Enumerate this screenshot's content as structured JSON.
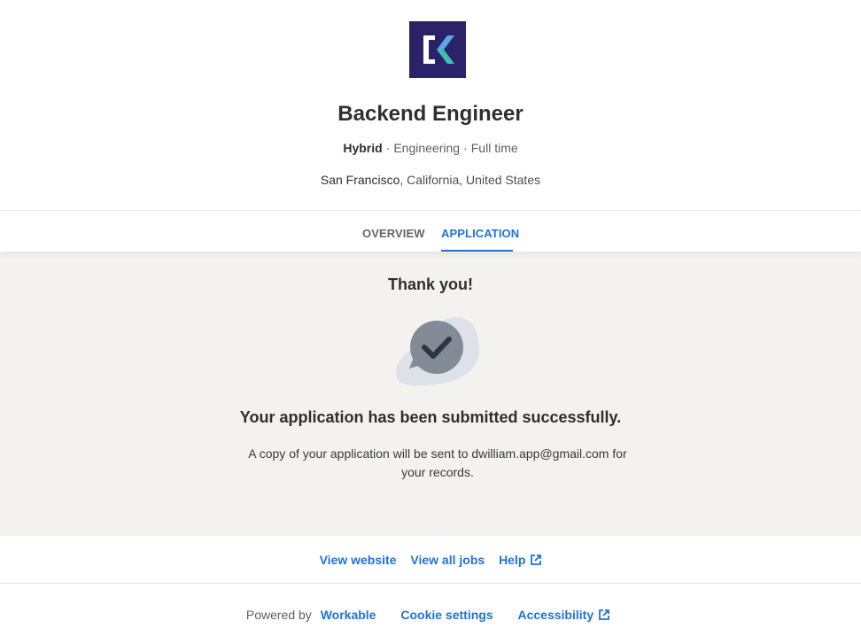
{
  "company": {
    "logo_icon": "company-k-logo-icon",
    "logo_bg": "#2b2368"
  },
  "job": {
    "title": "Backend Engineer",
    "workplace": "Hybrid",
    "department": "Engineering",
    "employment_type": "Full time",
    "separator": "·",
    "location_city": "San Francisco",
    "location_rest": ", California, United States"
  },
  "tabs": {
    "overview": "OVERVIEW",
    "application": "APPLICATION",
    "active": "application"
  },
  "confirmation": {
    "heading": "Thank you!",
    "illustration_icon": "chat-check-icon",
    "message": "Your application has been submitted successfully.",
    "note": "A copy of your application will be sent to dwilliam.app@gmail.com for your records."
  },
  "footer_links": {
    "view_website": "View website",
    "view_all_jobs": "View all jobs",
    "help": "Help"
  },
  "bottom": {
    "powered_by": "Powered by",
    "workable": "Workable",
    "cookie_settings": "Cookie settings",
    "accessibility": "Accessibility"
  },
  "colors": {
    "accent": "#1f73d9",
    "content_bg": "#f3f2ef",
    "text": "#2f2f2f"
  }
}
